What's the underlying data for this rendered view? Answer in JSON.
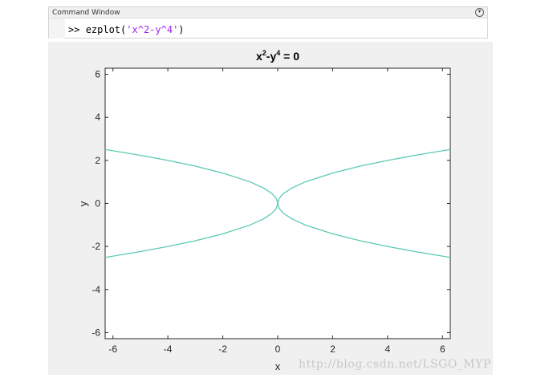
{
  "command_window": {
    "title": "Command Window",
    "prompt": ">>",
    "function": "ezplot(",
    "argument": "'x^2-y^4'",
    "close_paren": ")"
  },
  "watermark": "http://blog.csdn.net/LSGO_MYP",
  "chart_data": {
    "type": "line",
    "title_base": "x",
    "title_exp1": "2",
    "title_mid": "-y",
    "title_exp2": "4",
    "title_tail": " = 0",
    "xlabel": "x",
    "ylabel": "y",
    "xlim": [
      -6.2832,
      6.2832
    ],
    "ylim": [
      -6.2832,
      6.2832
    ],
    "xticks": [
      -6,
      -4,
      -2,
      0,
      2,
      4,
      6
    ],
    "yticks": [
      -6,
      -4,
      -2,
      0,
      2,
      4,
      6
    ],
    "color": "#5cc9b4",
    "series": [
      {
        "x": [
          -6.2832,
          -5.0,
          -4.0,
          -3.0,
          -2.0,
          -1.0,
          -0.5,
          -0.2,
          -0.05,
          0
        ],
        "y": [
          2.5066,
          2.2361,
          2.0,
          1.7321,
          1.4142,
          1.0,
          0.7071,
          0.4472,
          0.2236,
          0
        ]
      },
      {
        "x": [
          0,
          0.05,
          0.2,
          0.5,
          1.0,
          2.0,
          3.0,
          4.0,
          5.0,
          6.2832
        ],
        "y": [
          0,
          0.2236,
          0.4472,
          0.7071,
          1.0,
          1.4142,
          1.7321,
          2.0,
          2.2361,
          2.5066
        ]
      },
      {
        "x": [
          -6.2832,
          -5.0,
          -4.0,
          -3.0,
          -2.0,
          -1.0,
          -0.5,
          -0.2,
          -0.05,
          0
        ],
        "y": [
          -2.5066,
          -2.2361,
          -2.0,
          -1.7321,
          -1.4142,
          -1.0,
          -0.7071,
          -0.4472,
          -0.2236,
          0
        ]
      },
      {
        "x": [
          0,
          0.05,
          0.2,
          0.5,
          1.0,
          2.0,
          3.0,
          4.0,
          5.0,
          6.2832
        ],
        "y": [
          0,
          -0.2236,
          -0.4472,
          -0.7071,
          -1.0,
          -1.4142,
          -1.7321,
          -2.0,
          -2.2361,
          -2.5066
        ]
      }
    ]
  }
}
